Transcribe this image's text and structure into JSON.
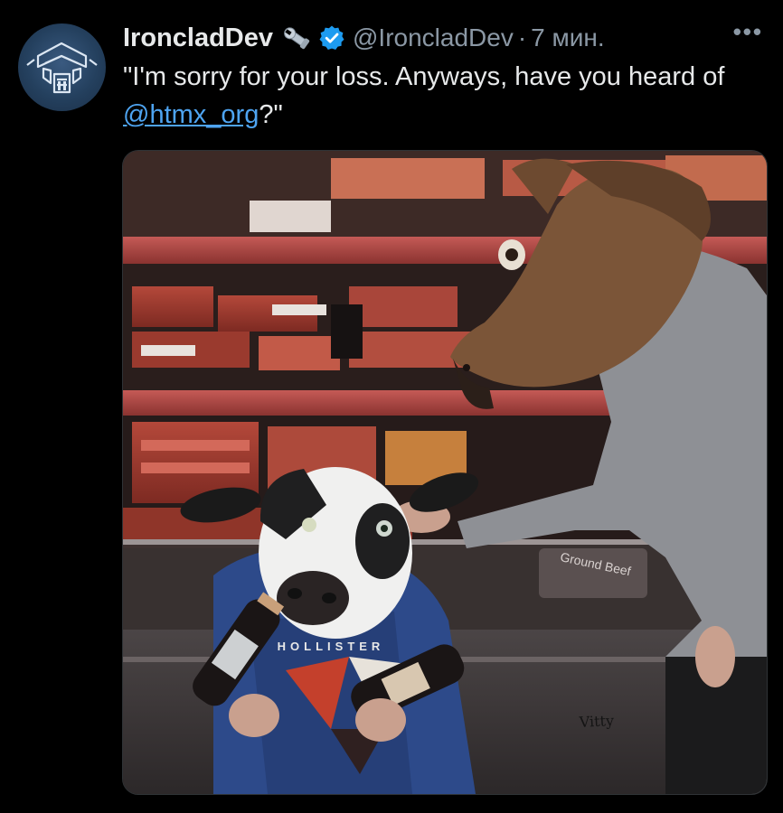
{
  "tweet": {
    "display_name": "IroncladDev",
    "handle": "@IroncladDev",
    "separator": "·",
    "timestamp": "7 мин.",
    "text_part1": "\"I'm sorry for your loss. Anyways, have you heard of ",
    "mention": "@htmx_org",
    "text_part2": "?\"",
    "more_label": "•••"
  },
  "media": {
    "sign_ground_beef": "Ground Beef",
    "shirt_text": "HOLLISTER",
    "watermark": "Vitty"
  },
  "colors": {
    "background": "#000000",
    "text": "#e7e9ea",
    "muted": "#8b98a5",
    "link": "#4ea4f1",
    "verified": "#1d9bf0"
  },
  "icons": {
    "avatar": "avatar-logo",
    "badge": "wrench-icon",
    "verified": "verified-badge-icon",
    "more": "more-icon"
  }
}
